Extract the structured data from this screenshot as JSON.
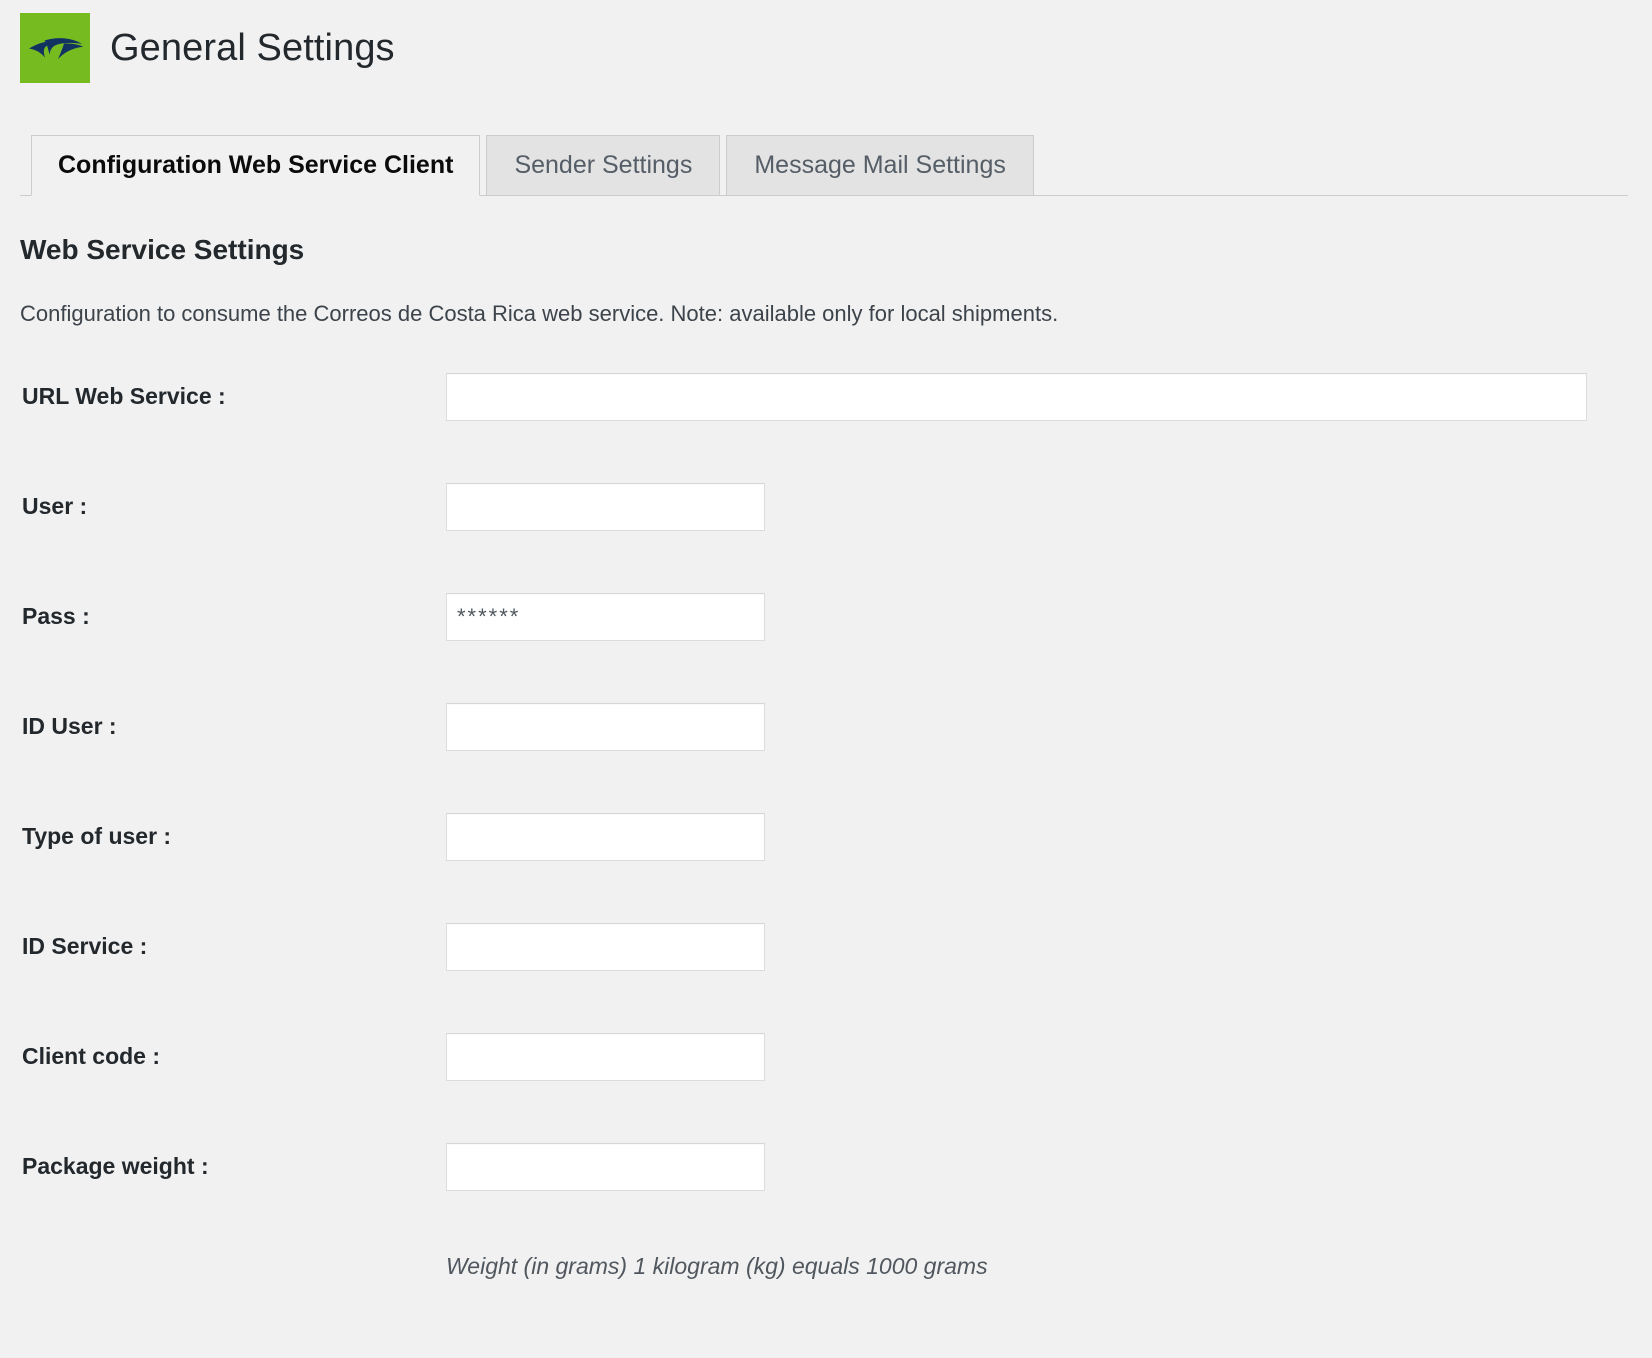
{
  "header": {
    "title": "General Settings",
    "logo_icon": "correos-bird-logo-icon",
    "logo_bg_color": "#76bc21",
    "logo_mark_color": "#123262"
  },
  "tabs": [
    {
      "label": "Configuration Web Service Client",
      "active": true
    },
    {
      "label": "Sender Settings",
      "active": false
    },
    {
      "label": "Message Mail Settings",
      "active": false
    }
  ],
  "section": {
    "heading": "Web Service Settings",
    "description": "Configuration to consume the Correos de Costa Rica web service. Note: available only for local shipments."
  },
  "fields": [
    {
      "label": "URL Web Service :",
      "value": "",
      "placeholder": "",
      "type": "text",
      "width": "wide"
    },
    {
      "label": "User :",
      "value": "",
      "placeholder": "",
      "type": "text",
      "width": "narrow"
    },
    {
      "label": "Pass :",
      "value": "******",
      "placeholder": "",
      "type": "text",
      "width": "narrow"
    },
    {
      "label": "ID User :",
      "value": "",
      "placeholder": "",
      "type": "text",
      "width": "narrow"
    },
    {
      "label": "Type of user :",
      "value": "",
      "placeholder": "",
      "type": "text",
      "width": "narrow"
    },
    {
      "label": "ID Service :",
      "value": "",
      "placeholder": "",
      "type": "text",
      "width": "narrow"
    },
    {
      "label": "Client code :",
      "value": "",
      "placeholder": "",
      "type": "text",
      "width": "narrow"
    },
    {
      "label": "Package weight :",
      "value": "",
      "placeholder": "",
      "type": "text",
      "width": "narrow"
    }
  ],
  "hints": {
    "package_weight": "Weight (in grams) 1 kilogram (kg) equals 1000 grams"
  }
}
